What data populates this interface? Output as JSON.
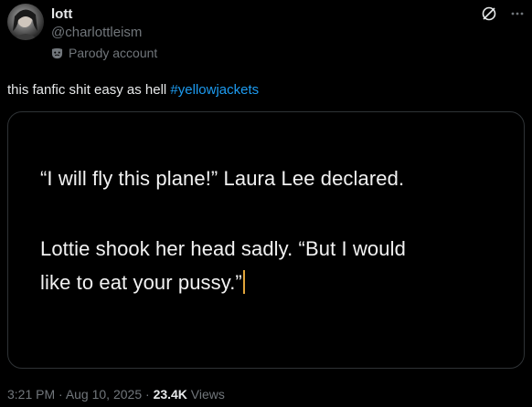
{
  "author": {
    "display_name": "lott",
    "handle": "@charlottleism",
    "account_label": "Parody account",
    "avatar_icon": "profile-photo",
    "label_icon": "theater-mask-icon"
  },
  "header_icons": [
    "grok-icon",
    "more-icon"
  ],
  "tweet": {
    "text": "this fanfic shit easy as hell ",
    "hashtag": "#yellowjackets"
  },
  "media": {
    "line1": "“I will fly this plane!” Laura Lee declared.",
    "line2": "Lottie shook her head sadly. “But I would",
    "line3": "like to eat your pussy.”",
    "cursor_color": "#e0a43a"
  },
  "meta": {
    "time": "3:21 PM",
    "sep1": " · ",
    "date": "Aug 10, 2025",
    "sep2": " · ",
    "views_count": "23.4K",
    "views_label": " Views"
  },
  "colors": {
    "background": "#000000",
    "text": "#e7e9ea",
    "muted": "#71767b",
    "link": "#1d9bf0",
    "border": "#2f3336"
  }
}
